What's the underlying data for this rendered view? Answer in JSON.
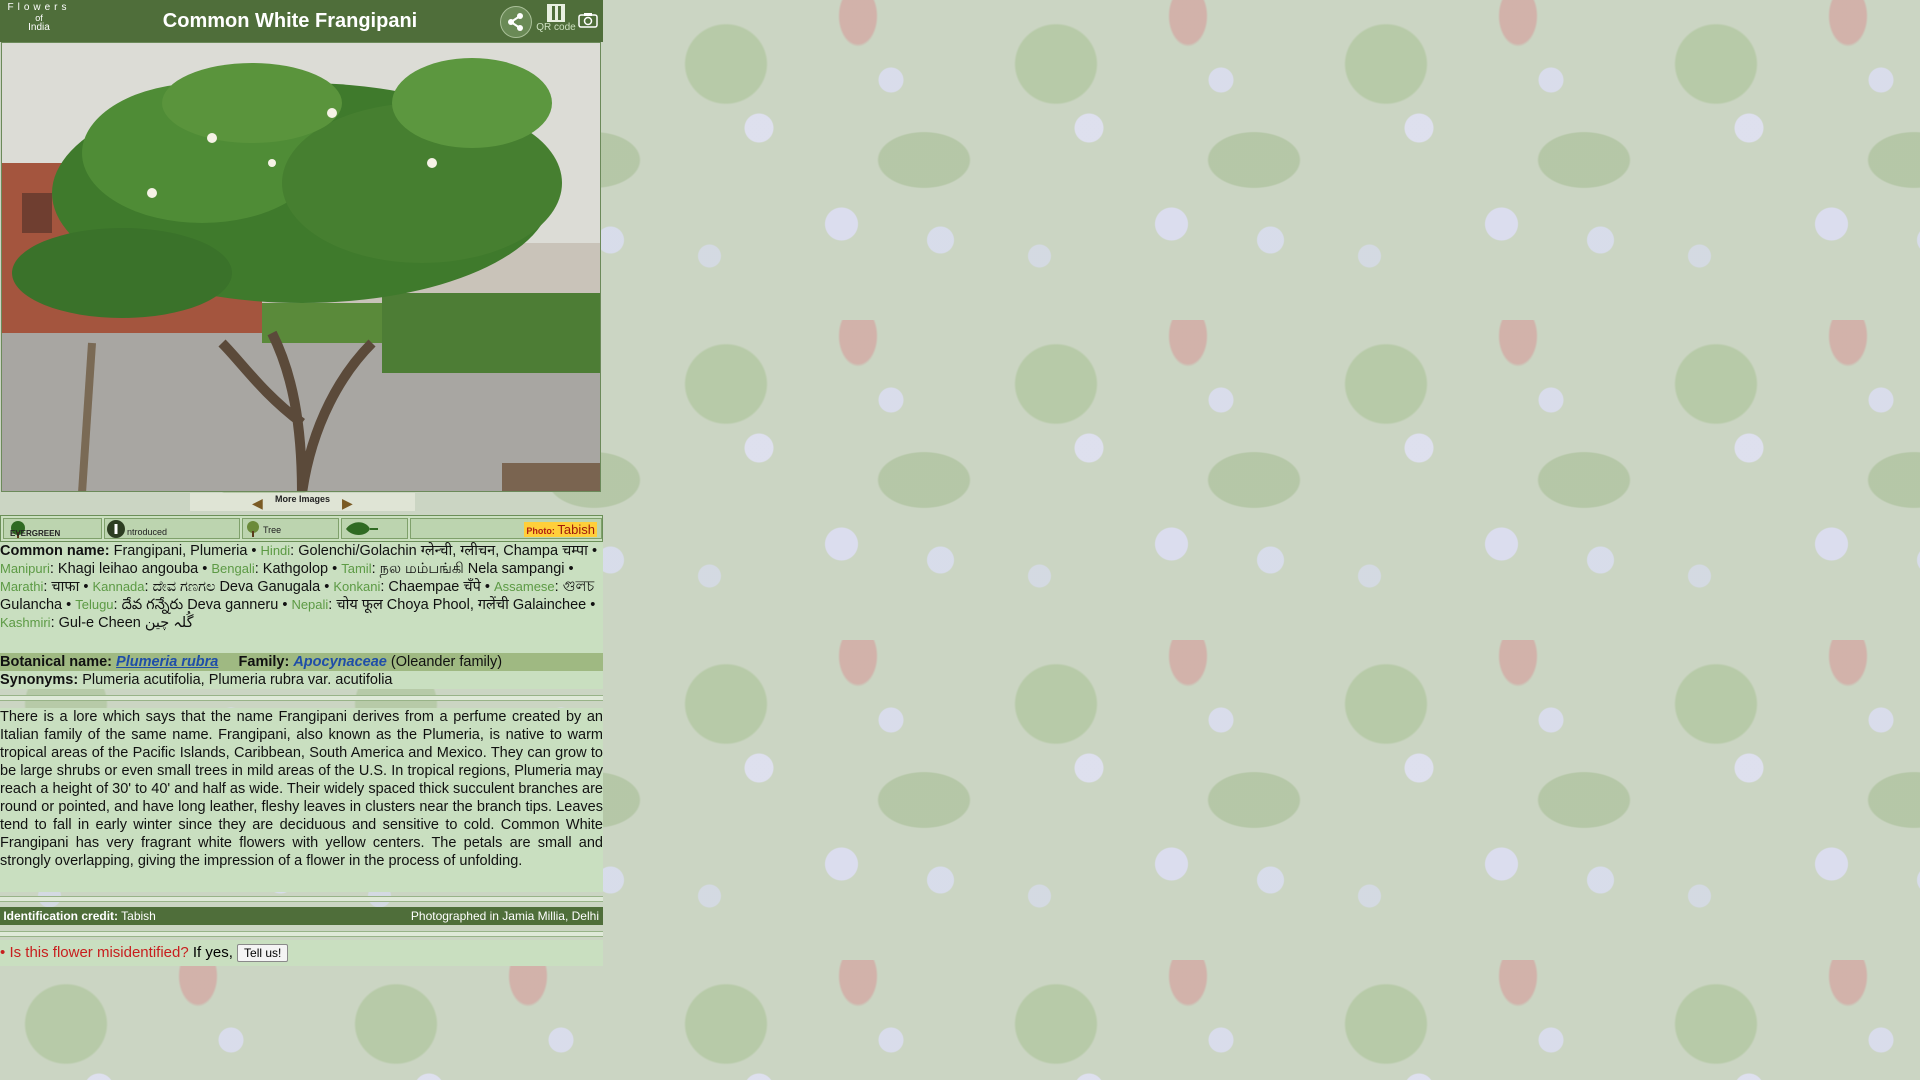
{
  "logo": {
    "line1": "Flowers",
    "line2": "of",
    "line3": "India"
  },
  "title": "Common White Frangipani",
  "qr_label": "QR code",
  "more_images": "More Images",
  "badges": {
    "evergreen": "EVERGREEN",
    "introduced": "ntroduced",
    "tree": "Tree"
  },
  "photo_credit": {
    "label": "Photo:",
    "name": "Tabish"
  },
  "names": {
    "common_label": "Common name:",
    "common_value": "Frangipani, Plumeria",
    "langs": [
      {
        "lang": "Hindi",
        "text": "Golenchi/Golachin ग्लेन्ची, ग्लीचन, Champa चम्पा"
      },
      {
        "lang": "Manipuri",
        "text": "Khagi leihao angouba"
      },
      {
        "lang": "Bengali",
        "text": "Kathgolop"
      },
      {
        "lang": "Tamil",
        "text": "நல மம்பங்கி Nela sampangi"
      },
      {
        "lang": "Marathi",
        "text": "चाफा"
      },
      {
        "lang": "Kannada",
        "text": "ದೇವ ಗಣಗಲ Deva Ganugala"
      },
      {
        "lang": "Konkani",
        "text": "Chaempae चँपे"
      },
      {
        "lang": "Assamese",
        "text": "গুলচ Gulancha"
      },
      {
        "lang": "Telugu",
        "text": "దేవ గన్నేరు Deva ganneru"
      },
      {
        "lang": "Nepali",
        "text": "चोय फूल Choya Phool, गलेंची Galainchee"
      },
      {
        "lang": "Kashmiri",
        "text": "Gul-e Cheen گُلہ چین"
      }
    ]
  },
  "botany": {
    "label": "Botanical name:",
    "name": "Plumeria rubra",
    "family_label": "Family:",
    "family": "Apocynaceae",
    "family_common": "(Oleander family)",
    "synonyms_label": "Synonyms:",
    "synonyms": "Plumeria acutifolia, Plumeria rubra var. acutifolia"
  },
  "description": "There is a lore which says that the name Frangipani derives from a perfume created by an Italian family of the same name. Frangipani, also known as the Plumeria, is native to warm tropical areas of the Pacific Islands, Caribbean, South America and Mexico. They can grow to be large shrubs or even small trees in mild areas of the U.S. In tropical regions, Plumeria may reach a height of 30' to 40' and half as wide. Their widely spaced thick succulent branches are round or pointed, and have long leather, fleshy leaves in clusters near the branch tips. Leaves tend to fall in early winter since they are deciduous and sensitive to cold. Common White Frangipani has very fragrant white flowers with yellow centers. The petals are small and strongly overlapping, giving the impression of a flower in the process of unfolding.",
  "credit": {
    "label": "Identification credit:",
    "name": "Tabish",
    "location": "Photographed in Jamia Millia, Delhi"
  },
  "misidentified": {
    "question": "Is this flower misidentified?",
    "prompt": "If yes,",
    "button": "Tell us!"
  },
  "colors": {
    "header": "#4f6e3a",
    "panel": "#c9dfc0",
    "link": "#1f4ea8",
    "alert": "#c81e1e"
  }
}
